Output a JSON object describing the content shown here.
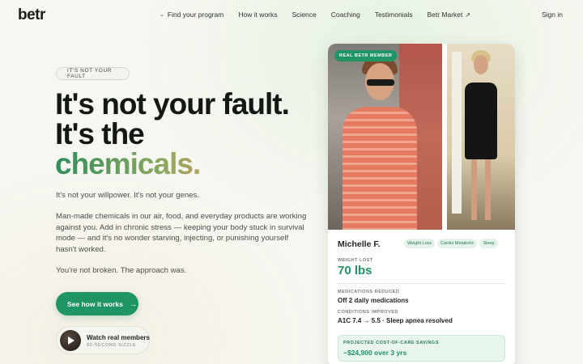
{
  "nav": {
    "logo": "betr",
    "links": [
      {
        "label": "Find your program",
        "icon": "chevron-down-icon"
      },
      {
        "label": "How it works"
      },
      {
        "label": "Science"
      },
      {
        "label": "Coaching"
      },
      {
        "label": "Testimonials"
      },
      {
        "label": "Betr Market",
        "icon": "external-arrow-icon"
      }
    ],
    "signin": "Sign in"
  },
  "hero": {
    "eyebrow": "IT'S NOT YOUR FAULT",
    "headline_line1": "It's not your fault.",
    "headline_line2": "It's the",
    "headline_line3": "chemicals.",
    "para1": "It's not your willpower. It's not your genes.",
    "para2": "Man-made chemicals in our air, food, and everyday products are working against you. Add in chronic stress — keeping your body stuck in survival mode — and it's no wonder starving, injecting, or punishing yourself hasn't worked.",
    "para3": "You're not broken. The approach was.",
    "cta_label": "See how it works",
    "cta_arrow": "→",
    "watch_title": "Watch real members",
    "watch_sub": "60-SECOND SIZZLE"
  },
  "card": {
    "badge": "REAL BETR MEMBER",
    "name": "Michelle F.",
    "tags": [
      "Weight Loss",
      "Cardio Metabolic",
      "Sleep"
    ],
    "weight_lost_label": "WEIGHT LOST",
    "weight_lost_value": "70 lbs",
    "meds_label": "MEDICATIONS REDUCED",
    "meds_value": "Off 2 daily medications",
    "conditions_label": "CONDITIONS IMPROVED",
    "conditions_value": "A1C 7.4 → 5.5 · Sleep apnea resolved",
    "savings_label": "PROJECTED COST-OF-CARE SAVINGS",
    "savings_value": "~$24,900 over 3 yrs"
  },
  "colors": {
    "brand_green": "#1f9464",
    "tag_bg": "#e4f3ea",
    "gradient_start": "#2f8e5b",
    "gradient_end": "#e48c7f"
  }
}
